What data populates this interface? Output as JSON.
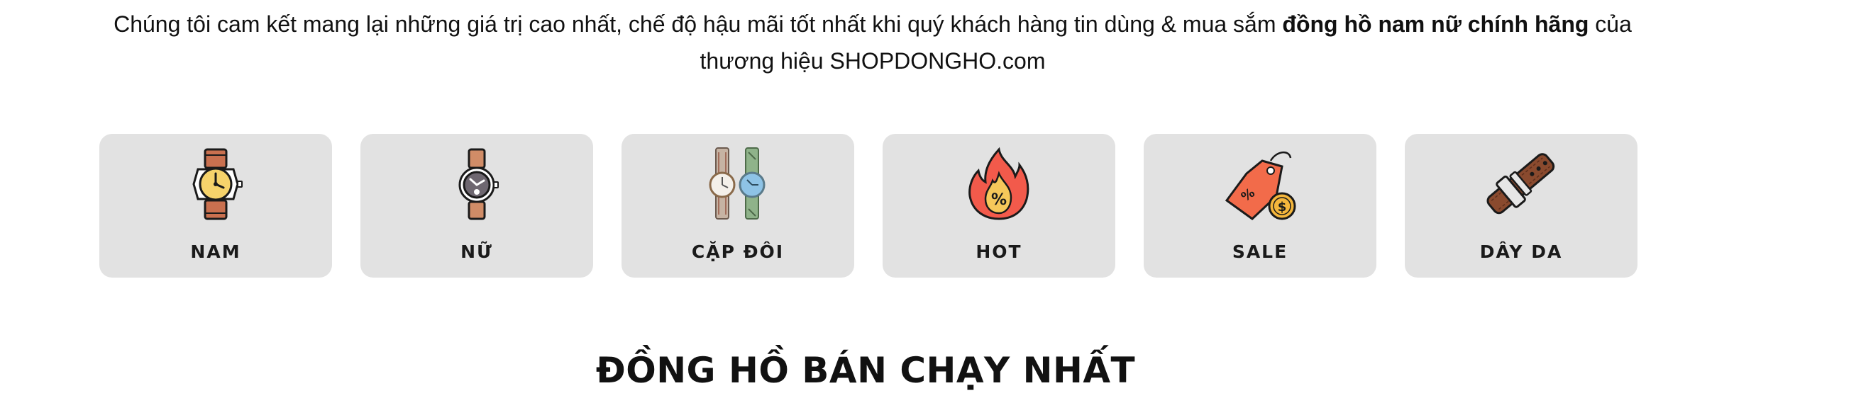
{
  "intro": {
    "line1_before": "Chúng tôi cam kết mang lại những giá trị cao nhất, chế độ hậu mãi tốt nhất khi quý khách hàng tin dùng & mua sắm ",
    "line1_bold": "đồng hồ nam nữ chính hãng",
    "line1_after": " của",
    "line2": "thương hiệu SHOPDONGHO.com"
  },
  "categories": [
    {
      "label": "NAM",
      "icon": "mens-watch-icon"
    },
    {
      "label": "NỮ",
      "icon": "womens-watch-icon"
    },
    {
      "label": "CẶP ĐÔI",
      "icon": "couple-watches-icon"
    },
    {
      "label": "HOT",
      "icon": "fire-percent-icon"
    },
    {
      "label": "SALE",
      "icon": "sale-tag-icon"
    },
    {
      "label": "DÂY DA",
      "icon": "leather-strap-icon"
    }
  ],
  "section": {
    "title": "ĐỒNG HỒ BÁN CHẠY NHẤT"
  },
  "colors": {
    "card_background": "#e2e2e2",
    "text": "#111111",
    "fire_red": "#f25a4b",
    "tag_orange": "#f26b4a",
    "coin_gold": "#f4b63c",
    "strap_brown": "#8a4a2e"
  }
}
